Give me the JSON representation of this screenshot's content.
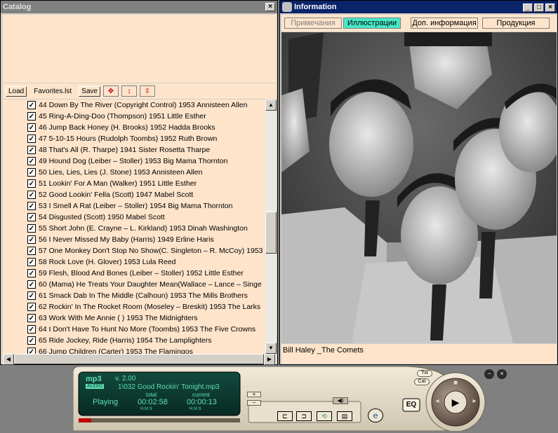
{
  "catalog": {
    "title": "Catalog",
    "close_label": "×",
    "load_label": "Load",
    "file_name": "Favorites.lst",
    "save_label": "Save",
    "items": [
      "44 Down By The River (Copyright Control) 1953 Annisteen Allen",
      "45 Ring-A-Ding-Doo (Thompson) 1951 Little Esther",
      "46 Jump Back Honey (H. Brooks) 1952 Hadda Brooks",
      "47 5-10-15 Hours (Rudolph Toombs) 1952 Ruth Brown",
      "48 That's All (R. Tharpe) 1941 Sister Rosetta Tharpe",
      "49 Hound Dog (Leiber – Stoller) 1953 Big Mama Thornton",
      "50 Lies, Lies, Lies (J. Stone) 1953 Annisteen Allen",
      "51 Lookin' For A Man (Walker) 1951 Little Esther",
      "52 Good Lookin' Fella (Scott) 1947 Mabel Scott",
      "53 I Smell A Rat (Leiber – Stoller) 1954 Big Mama Thornton",
      "54 Disgusted (Scott) 1950 Mabel Scott",
      "55 Short John (E. Crayne – L. Kirkland) 1953 Dinah Washington",
      "56 I Never Missed My Baby (Harris) 1949 Erline Haris",
      "57 One Monkey Don't Stop No Show(C. Singleton – R. McCoy) 1953",
      "58 Rock Love (H. Glover) 1953 Lula Reed",
      "59 Flesh, Blood And Bones (Leiber – Stoller) 1952 Little Esther",
      "60 (Mama) He Treats Your Daughter Mean(Wallace – Lance – Singe",
      "61 Smack Dab In The Middle (Calhoun) 1953 The Mills Brothers",
      "62 Rockin' In The Rocket Room (Moseley – Breskit) 1953 The Larks",
      "63 Work With Me Annie ( ) 1953 The Midnighters",
      "64 I Don't Have To Hunt No More (Toombs) 1953 The Five Crowns",
      "65 Ride Jockey, Ride (Harris) 1954 The Lamplighters",
      "66 Jump Children (Carter) 1953 The Flamingos"
    ]
  },
  "info": {
    "title": "Information",
    "tabs": [
      "Примечания",
      "Иллюстрации",
      "Доп. информация",
      "Продукция"
    ],
    "selected_tab": 1,
    "caption": "Bill Haley _The Comets"
  },
  "player": {
    "logo": "mp3",
    "logo_sub": "AUDIO",
    "version": "v. 2.00",
    "track": "1\\032 Good Rockin' Tonight.mp3",
    "status": "Playing",
    "total_label": "total",
    "total_time": "00:02:58",
    "current_label": "current",
    "current_time": "00:00:13",
    "hms": "H  M  S",
    "eq_label": "EQ",
    "txt_label": "Txt",
    "cat_label": "Cat",
    "colors": {
      "display_bg": "#0c3a30",
      "display_text": "#5fe0b0",
      "accent": "#46e8c8"
    }
  }
}
